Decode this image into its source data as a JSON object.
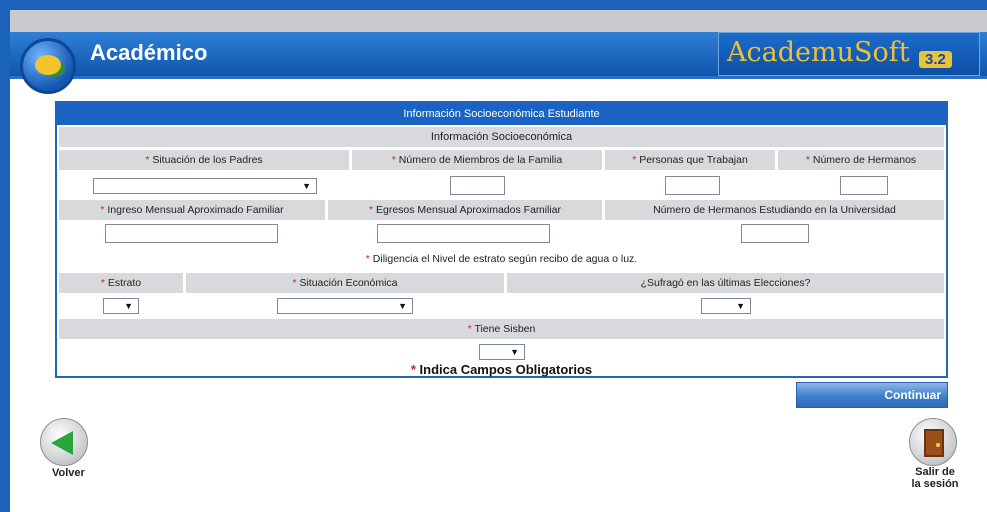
{
  "header": {
    "app_title": "Académico",
    "brand_name": "AcademuSoft",
    "brand_version": "3.2"
  },
  "form": {
    "title": "Información Socioeconómica Estudiante",
    "section_title": "Información Socioeconómica",
    "required_mark": "*",
    "fields": {
      "situacion_padres": {
        "label": "Situación de los Padres",
        "value": ""
      },
      "miembros_familia": {
        "label": "Número de Miembros de la Familia",
        "value": ""
      },
      "personas_trabajan": {
        "label": "Personas que Trabajan",
        "value": ""
      },
      "numero_hermanos": {
        "label": "Número de Hermanos",
        "value": ""
      },
      "ingreso_mensual": {
        "label": "Ingreso Mensual Aproximado Familiar",
        "value": ""
      },
      "egresos_mensual": {
        "label": "Egresos Mensual Aproximados Familiar",
        "value": ""
      },
      "hermanos_universidad": {
        "label": "Número de Hermanos Estudiando en la Universidad",
        "value": ""
      },
      "estrato": {
        "label": "Estrato",
        "value": ""
      },
      "situacion_economica": {
        "label": "Situación Económica",
        "value": ""
      },
      "sufrago": {
        "label": "¿Sufragó en las últimas Elecciones?",
        "value": ""
      },
      "tiene_sisben": {
        "label": "Tiene Sisben",
        "value": ""
      }
    },
    "note": "Diligencia el Nivel de estrato según recibo de agua o luz.",
    "required_legend": "Indica Campos Obligatorios"
  },
  "actions": {
    "continue_label": "Continuar",
    "back_label": "Volver",
    "exit_label_line1": "Salir de",
    "exit_label_line2": "la sesión"
  }
}
